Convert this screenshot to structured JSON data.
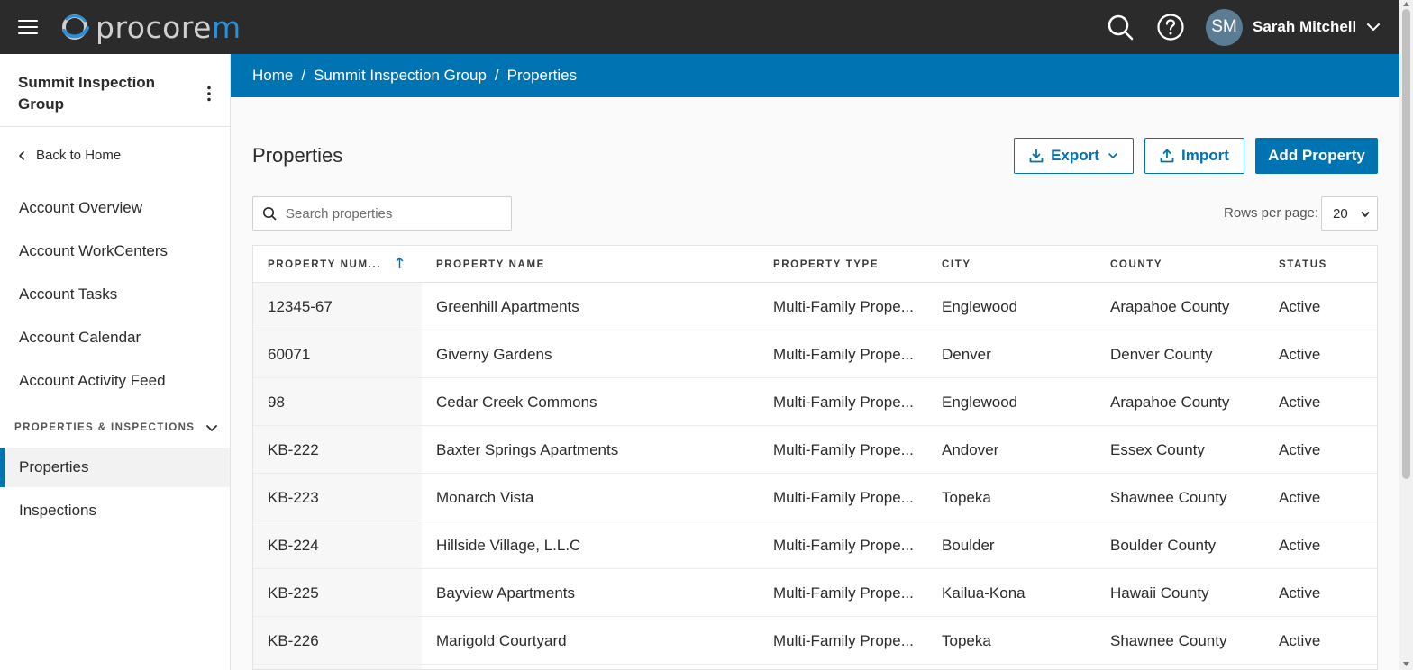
{
  "app": {
    "logo_text_main": "procore",
    "logo_text_accent": "m"
  },
  "user": {
    "initials": "SM",
    "name": "Sarah Mitchell"
  },
  "sidebar": {
    "org_name": "Summit Inspection Group",
    "back_label": "Back to Home",
    "items": [
      {
        "label": "Account Overview"
      },
      {
        "label": "Account WorkCenters"
      },
      {
        "label": "Account Tasks"
      },
      {
        "label": "Account Calendar"
      },
      {
        "label": "Account Activity Feed"
      }
    ],
    "section_label": "PROPERTIES & INSPECTIONS",
    "section_items": [
      {
        "label": "Properties",
        "active": true
      },
      {
        "label": "Inspections",
        "active": false
      }
    ]
  },
  "breadcrumb": {
    "items": [
      "Home",
      "Summit Inspection Group",
      "Properties"
    ],
    "separator": "/"
  },
  "main": {
    "title": "Properties",
    "export_label": "Export",
    "import_label": "Import",
    "add_label": "Add Property",
    "search_placeholder": "Search properties",
    "rows_per_page_label": "Rows per page:",
    "rows_per_page_value": "20"
  },
  "table": {
    "columns": [
      "PROPERTY NUM...",
      "PROPERTY NAME",
      "PROPERTY TYPE",
      "CITY",
      "COUNTY",
      "STATUS"
    ],
    "rows": [
      [
        "12345-67",
        "Greenhill Apartments",
        "Multi-Family Prope...",
        "Englewood",
        "Arapahoe County",
        "Active"
      ],
      [
        "60071",
        "Giverny Gardens",
        "Multi-Family Prope...",
        "Denver",
        "Denver County",
        "Active"
      ],
      [
        "98",
        "Cedar Creek Commons",
        "Multi-Family Prope...",
        "Englewood",
        "Arapahoe County",
        "Active"
      ],
      [
        "KB-222",
        "Baxter Springs Apartments",
        "Multi-Family Prope...",
        "Andover",
        "Essex County",
        "Active"
      ],
      [
        "KB-223",
        "Monarch Vista",
        "Multi-Family Prope...",
        "Topeka",
        "Shawnee County",
        "Active"
      ],
      [
        "KB-224",
        "Hillside Village, L.L.C",
        "Multi-Family Prope...",
        "Boulder",
        "Boulder County",
        "Active"
      ],
      [
        "KB-225",
        "Bayview Apartments",
        "Multi-Family Prope...",
        "Kailua-Kona",
        "Hawaii County",
        "Active"
      ],
      [
        "KB-226",
        "Marigold Courtyard",
        "Multi-Family Prope...",
        "Topeka",
        "Shawnee County",
        "Active"
      ]
    ]
  },
  "colors": {
    "topbar": "#2b2b2b",
    "brand_blue": "#0073b2",
    "logo_accent": "#2d8fd5",
    "avatar": "#5a7d95"
  },
  "icons": [
    "hamburger-icon",
    "procore-logo-icon",
    "search-icon",
    "help-icon",
    "chevron-down-icon",
    "kebab-menu-icon",
    "chevron-left-icon",
    "download-icon",
    "upload-icon",
    "sort-ascending-icon"
  ]
}
